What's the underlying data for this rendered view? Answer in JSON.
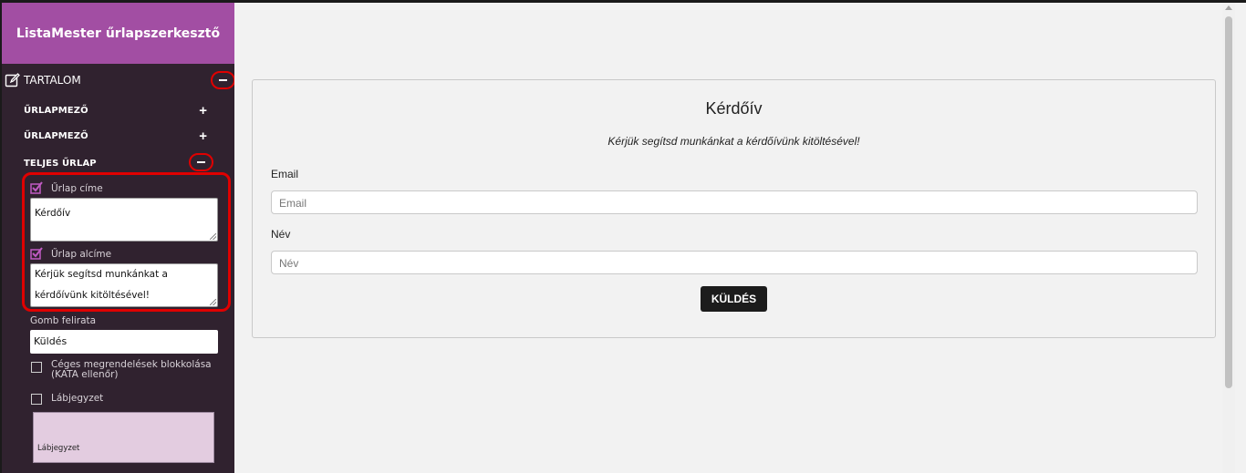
{
  "app": {
    "title": "ListaMester űrlapszerkesztő"
  },
  "colors": {
    "brand": "#a24ea3",
    "sidebar_bg": "#30222f",
    "highlight": "#e00000",
    "footer_box": "#e3cce0",
    "button": "#1c1c1c"
  },
  "sidebar": {
    "section_label": "TARTALOM",
    "section_icon": "edit-icon",
    "items": [
      {
        "label": "ŰRLAPMEZŐ",
        "state": "collapsed"
      },
      {
        "label": "ŰRLAPMEZŐ",
        "state": "collapsed"
      },
      {
        "label": "TELJES ŰRLAP",
        "state": "expanded"
      }
    ],
    "form_title": {
      "label": "Űrlap címe",
      "checked": true,
      "value": "Kérdőív"
    },
    "form_subtitle": {
      "label": "Űrlap alcíme",
      "checked": true,
      "value": "Kérjük segítsd munkánkat a kérdőívünk kitöltésével!"
    },
    "button_caption": {
      "label": "Gomb felirata",
      "value": "Küldés"
    },
    "company_block": {
      "label": "Céges megrendelések blokkolása (KATA ellenőr)",
      "checked": false
    },
    "footer": {
      "label": "Lábjegyzet",
      "checked": false,
      "value": "Lábjegyzet"
    }
  },
  "preview": {
    "title": "Kérdőív",
    "subtitle": "Kérjük segítsd munkánkat a kérdőívünk kitöltésével!",
    "fields": [
      {
        "label": "Email",
        "placeholder": "Email"
      },
      {
        "label": "Név",
        "placeholder": "Név"
      }
    ],
    "submit_label": "KÜLDÉS"
  }
}
